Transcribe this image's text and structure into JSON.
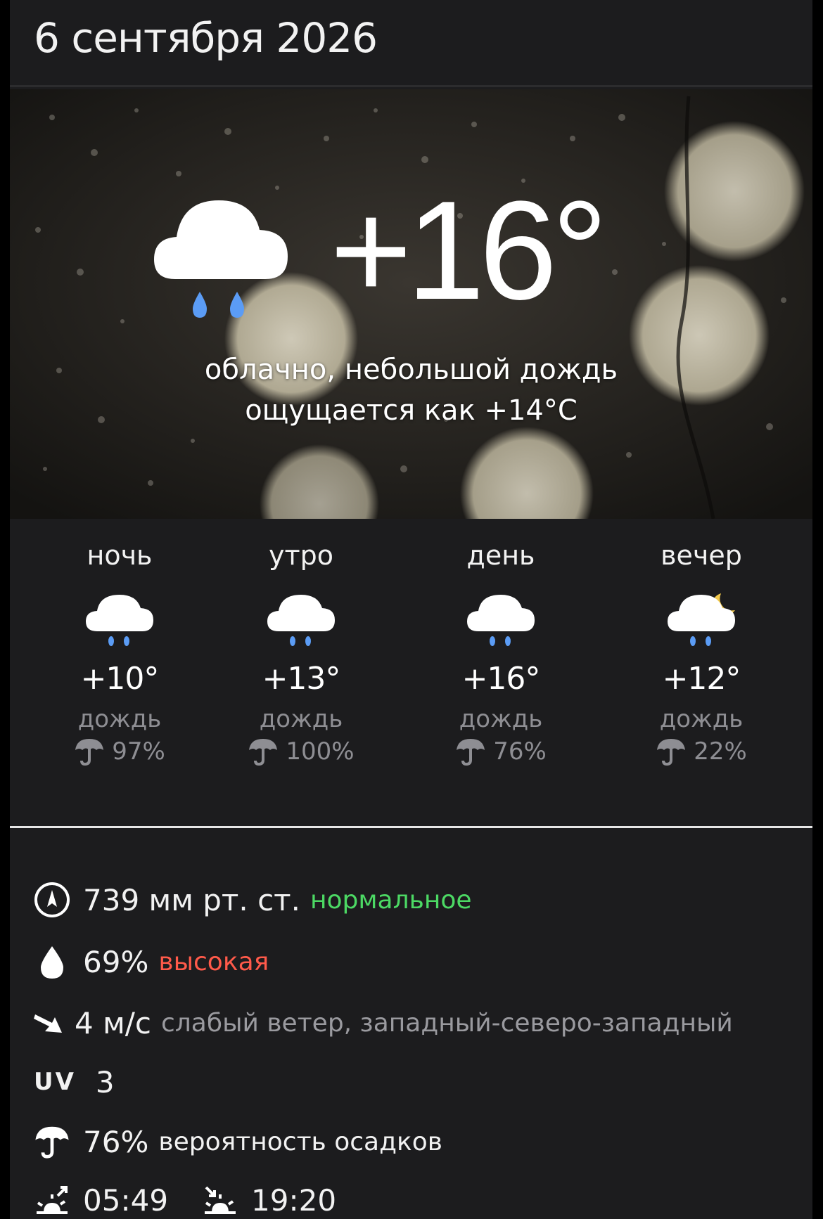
{
  "header": {
    "date": "6 сентября 2026"
  },
  "current": {
    "temperature": "+16°",
    "condition": "облачно, небольшой дождь",
    "feels_like": "ощущается как +14°C",
    "icon": "cloud-rain-icon"
  },
  "periods": [
    {
      "name": "ночь",
      "temp": "+10°",
      "condition": "дождь",
      "precip": "97%",
      "icon": "cloud-rain-icon"
    },
    {
      "name": "утро",
      "temp": "+13°",
      "condition": "дождь",
      "precip": "100%",
      "icon": "cloud-rain-icon"
    },
    {
      "name": "день",
      "temp": "+16°",
      "condition": "дождь",
      "precip": "76%",
      "icon": "cloud-rain-icon"
    },
    {
      "name": "вечер",
      "temp": "+12°",
      "condition": "дождь",
      "precip": "22%",
      "icon": "cloud-moon-rain-icon"
    }
  ],
  "details": {
    "pressure": {
      "value": "739 мм рт. ст.",
      "note": "нормальное",
      "icon": "pressure-icon"
    },
    "humidity": {
      "value": "69%",
      "note": "высокая",
      "icon": "drop-icon"
    },
    "wind": {
      "value": "4 м/с",
      "note": "слабый ветер, западный-северо-западный",
      "icon": "wind-arrow-icon"
    },
    "uv": {
      "label": "UV",
      "value": "3"
    },
    "precip": {
      "value": "76%",
      "note": "вероятность осадков",
      "icon": "umbrella-icon"
    },
    "sunrise": {
      "value": "05:49",
      "icon": "sunrise-icon"
    },
    "sunset": {
      "value": "19:20",
      "icon": "sunset-icon"
    }
  },
  "colors": {
    "background": "#1c1c1e",
    "accent_green": "#4cd964",
    "accent_red": "#ff5a4a",
    "rain_drop": "#5b9cf5",
    "moon": "#f2c94c"
  }
}
